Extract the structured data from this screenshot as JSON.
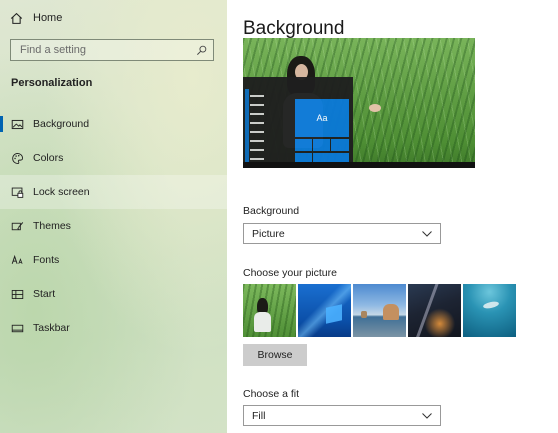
{
  "sidebar": {
    "home_label": "Home",
    "search_placeholder": "Find a setting",
    "section_title": "Personalization",
    "items": [
      {
        "label": "Background",
        "icon": "picture-icon"
      },
      {
        "label": "Colors",
        "icon": "palette-icon"
      },
      {
        "label": "Lock screen",
        "icon": "lock-screen-icon"
      },
      {
        "label": "Themes",
        "icon": "themes-brush-icon"
      },
      {
        "label": "Fonts",
        "icon": "fonts-icon"
      },
      {
        "label": "Start",
        "icon": "start-icon"
      },
      {
        "label": "Taskbar",
        "icon": "taskbar-icon"
      }
    ],
    "active_item": "Background",
    "hovered_item": "Lock screen"
  },
  "main": {
    "title": "Background",
    "preview": {
      "tile_text": "Aa"
    },
    "background_label": "Background",
    "background_value": "Picture",
    "choose_picture_label": "Choose your picture",
    "browse_label": "Browse",
    "choose_fit_label": "Choose a fit",
    "fit_value": "Fill"
  },
  "colors": {
    "accent": "#0078d7",
    "active_indicator": "#0063b1",
    "button_bg": "#cccccc"
  }
}
